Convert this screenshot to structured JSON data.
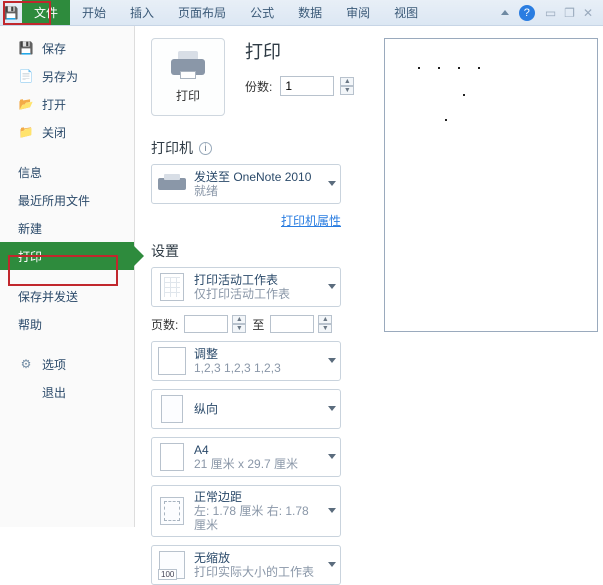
{
  "ribbon": {
    "tabs": {
      "file": "文件",
      "home": "开始",
      "insert": "插入",
      "layout": "页面布局",
      "formulas": "公式",
      "data": "数据",
      "review": "审阅",
      "view": "视图"
    },
    "help": "?"
  },
  "nav": {
    "save": "保存",
    "saveas": "另存为",
    "open": "打开",
    "close": "关闭",
    "info": "信息",
    "recent": "最近所用文件",
    "new": "新建",
    "print": "打印",
    "saveSend": "保存并发送",
    "help": "帮助",
    "options": "选项",
    "exit": "退出"
  },
  "print": {
    "title": "打印",
    "btnLabel": "打印",
    "copiesLabel": "份数:",
    "copiesValue": "1"
  },
  "printer": {
    "heading": "打印机",
    "name": "发送至 OneNote 2010",
    "status": "就绪",
    "propsLink": "打印机属性"
  },
  "settings": {
    "heading": "设置",
    "what": {
      "main": "打印活动工作表",
      "sub": "仅打印活动工作表"
    },
    "pagesLabel": "页数:",
    "toLabel": "至",
    "collate": {
      "main": "调整",
      "sub": "1,2,3   1,2,3   1,2,3"
    },
    "orient": {
      "main": "纵向"
    },
    "paper": {
      "main": "A4",
      "sub": "21 厘米 x 29.7 厘米"
    },
    "margins": {
      "main": "正常边距",
      "sub": "左: 1.78 厘米  右: 1.78 厘米"
    },
    "scale": {
      "main": "无缩放",
      "sub": "打印实际大小的工作表",
      "badge": "100"
    }
  }
}
